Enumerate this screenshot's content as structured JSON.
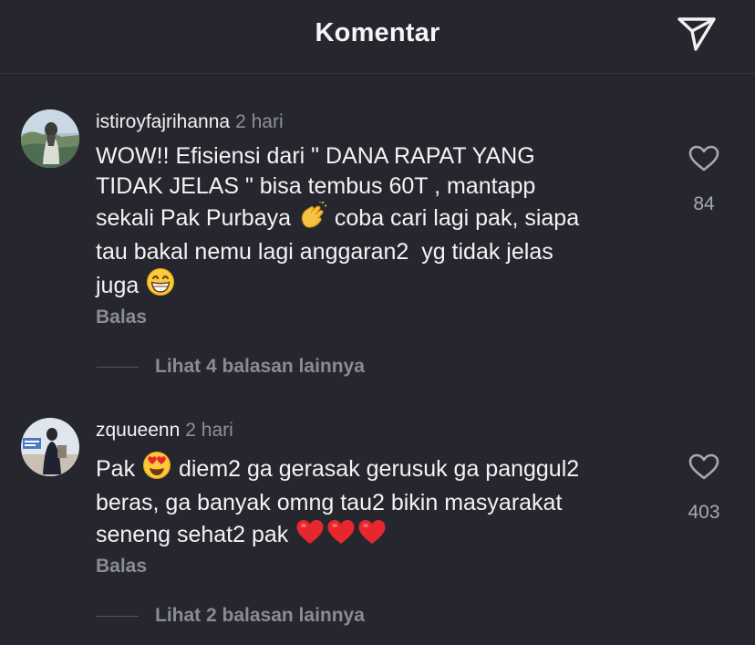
{
  "header": {
    "title": "Komentar",
    "share_icon": "paper-plane-icon"
  },
  "comments": [
    {
      "username": "istiroyfajrihanna",
      "time": "2 hari",
      "text_parts": [
        "WOW!! Efisiensi dari \" DANA RAPAT YANG\nTIDAK JELAS \" bisa tembus 60T , mantapp\nsekali Pak Purbaya ",
        " coba cari lagi pak, siapa\ntau bakal nemu lagi anggaran2  yg tidak jelas\njuga "
      ],
      "emojis": [
        "clapping-hands",
        "grinning-face"
      ],
      "reply_label": "Balas",
      "like_count": "84",
      "view_replies": "Lihat 4 balasan lainnya"
    },
    {
      "username": "zquueenn",
      "time": "2 hari",
      "text_parts": [
        "Pak ",
        " diem2 ga gerasak gerusuk ga panggul2\nberas, ga banyak omng tau2 bikin masyarakat\nseneng sehat2 pak "
      ],
      "emojis": [
        "heart-eyes-face",
        "red-heart",
        "red-heart",
        "red-heart"
      ],
      "reply_label": "Balas",
      "like_count": "403",
      "view_replies": "Lihat 2 balasan lainnya"
    }
  ],
  "colors": {
    "background": "#26272e",
    "primary_text": "#f2f2f4",
    "secondary_text": "#8a8b94",
    "heart_red": "#e8262d"
  }
}
